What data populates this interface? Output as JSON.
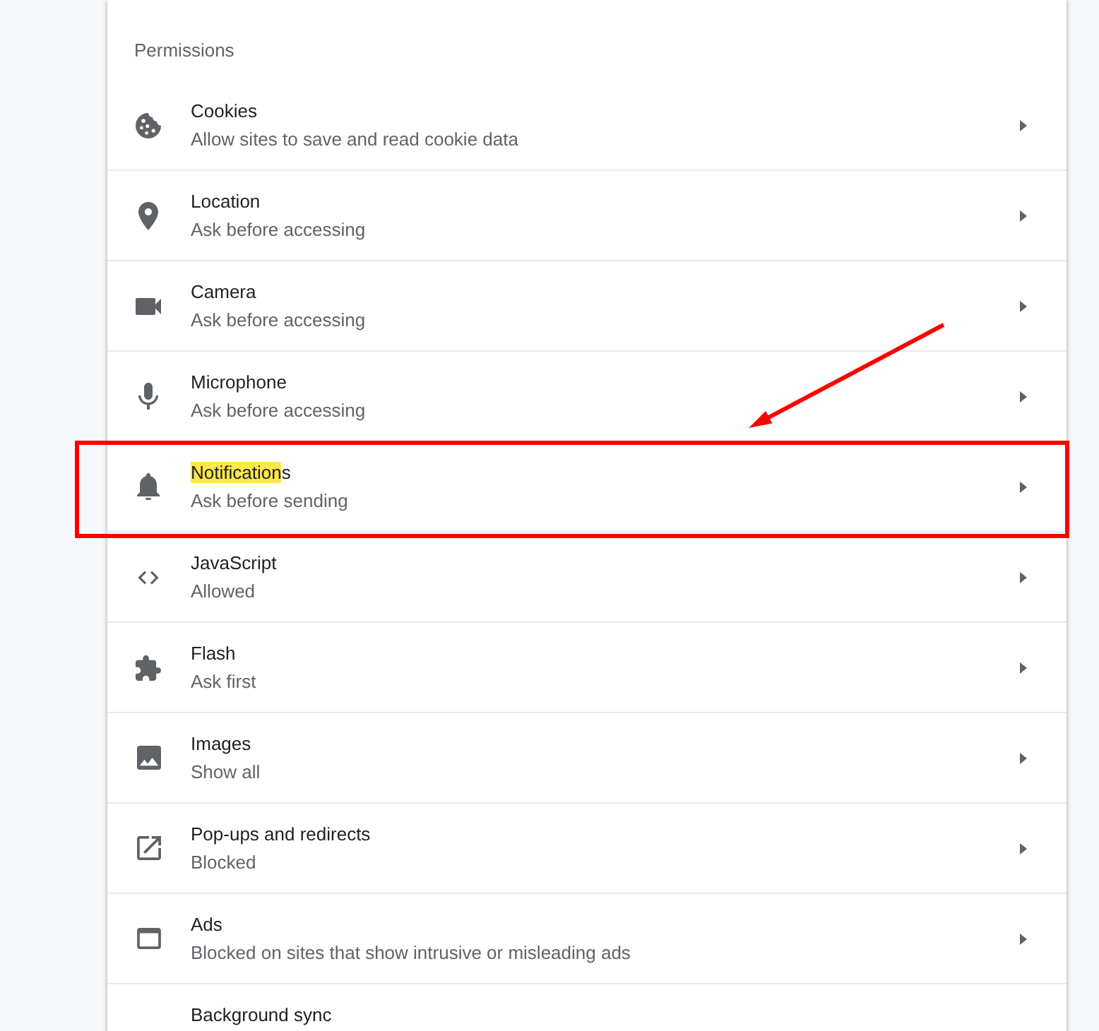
{
  "section": {
    "title": "Permissions"
  },
  "permissions": [
    {
      "title_parts": [
        {
          "text": "Cookies",
          "highlighted": false
        }
      ],
      "subtitle": "Allow sites to save and read cookie data",
      "framed": false
    },
    {
      "title_parts": [
        {
          "text": "Location",
          "highlighted": false
        }
      ],
      "subtitle": "Ask before accessing",
      "framed": false
    },
    {
      "title_parts": [
        {
          "text": "Camera",
          "highlighted": false
        }
      ],
      "subtitle": "Ask before accessing",
      "framed": false
    },
    {
      "title_parts": [
        {
          "text": "Microphone",
          "highlighted": false
        }
      ],
      "subtitle": "Ask before accessing",
      "framed": false
    },
    {
      "title_parts": [
        {
          "text": "Notification",
          "highlighted": true
        },
        {
          "text": "s",
          "highlighted": false
        }
      ],
      "subtitle": "Ask before sending",
      "framed": true
    },
    {
      "title_parts": [
        {
          "text": "JavaScript",
          "highlighted": false
        }
      ],
      "subtitle": "Allowed",
      "framed": false
    },
    {
      "title_parts": [
        {
          "text": "Flash",
          "highlighted": false
        }
      ],
      "subtitle": "Ask first",
      "framed": false
    },
    {
      "title_parts": [
        {
          "text": "Images",
          "highlighted": false
        }
      ],
      "subtitle": "Show all",
      "framed": false
    },
    {
      "title_parts": [
        {
          "text": "Pop-ups and redirects",
          "highlighted": false
        }
      ],
      "subtitle": "Blocked",
      "framed": false
    },
    {
      "title_parts": [
        {
          "text": "Ads",
          "highlighted": false
        }
      ],
      "subtitle": "Blocked on sites that show intrusive or misleading ads",
      "framed": false
    },
    {
      "title_parts": [
        {
          "text": "Background sync",
          "highlighted": false
        }
      ],
      "framed": false
    }
  ]
}
